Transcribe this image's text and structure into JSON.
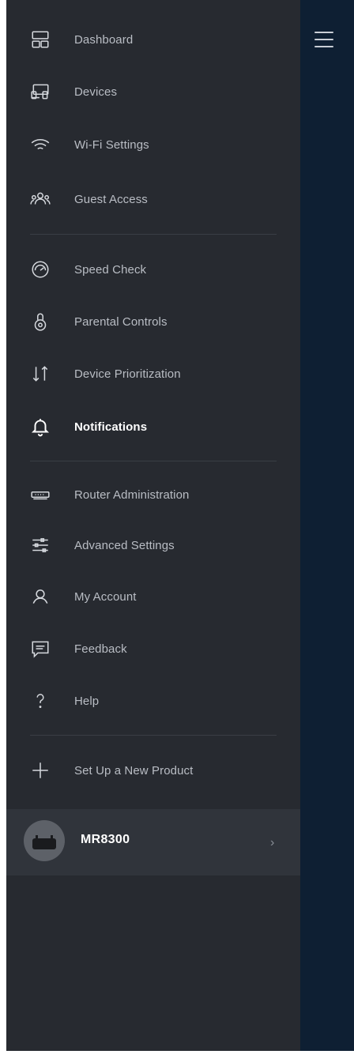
{
  "menu": {
    "items": [
      {
        "label": "Dashboard",
        "icon": "dashboard-icon"
      },
      {
        "label": "Devices",
        "icon": "devices-icon"
      },
      {
        "label": "Wi-Fi Settings",
        "icon": "wifi-icon"
      },
      {
        "label": "Guest Access",
        "icon": "guest-access-icon"
      },
      {
        "label": "Speed Check",
        "icon": "speedometer-icon"
      },
      {
        "label": "Parental Controls",
        "icon": "lock-icon"
      },
      {
        "label": "Device Prioritization",
        "icon": "priority-arrows-icon"
      },
      {
        "label": "Notifications",
        "icon": "bell-icon",
        "active": true
      },
      {
        "label": "Router Administration",
        "icon": "router-icon"
      },
      {
        "label": "Advanced Settings",
        "icon": "sliders-icon"
      },
      {
        "label": "My Account",
        "icon": "person-icon"
      },
      {
        "label": "Feedback",
        "icon": "feedback-icon"
      },
      {
        "label": "Help",
        "icon": "question-icon"
      },
      {
        "label": "Set Up a New Product",
        "icon": "plus-icon"
      }
    ]
  },
  "product": {
    "name": "MR8300",
    "chevron": "›"
  },
  "colors": {
    "drawer_bg": "#272a30",
    "main_bg": "#0e1f33",
    "active_text": "#ffffff",
    "text": "#b9bdc4"
  }
}
